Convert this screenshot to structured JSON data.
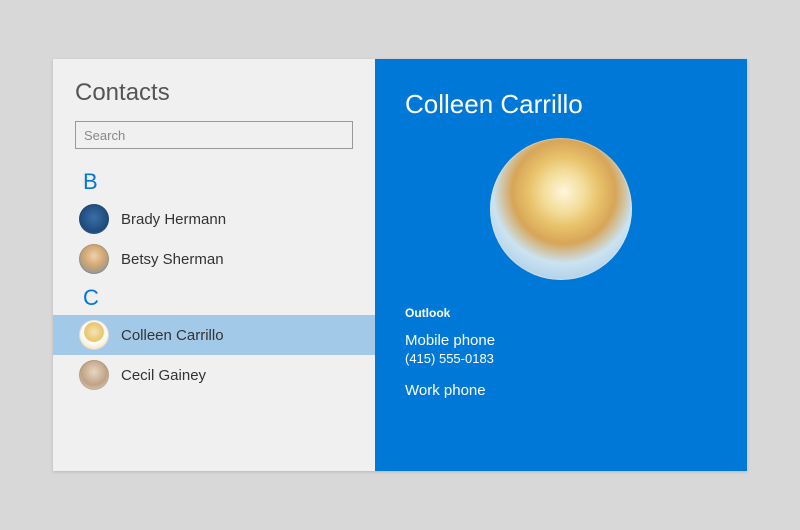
{
  "sidebar": {
    "title": "Contacts",
    "search_placeholder": "Search",
    "groups": [
      {
        "letter": "B",
        "items": [
          {
            "name": "Brady Hermann",
            "avatar": "av-brady",
            "selected": false
          },
          {
            "name": "Betsy Sherman",
            "avatar": "av-betsy",
            "selected": false
          }
        ]
      },
      {
        "letter": "C",
        "items": [
          {
            "name": "Colleen Carrillo",
            "avatar": "av-colleen",
            "selected": true
          },
          {
            "name": "Cecil Gainey",
            "avatar": "av-cecil",
            "selected": false
          }
        ]
      }
    ]
  },
  "detail": {
    "name": "Colleen Carrillo",
    "source": "Outlook",
    "fields": [
      {
        "label": "Mobile phone",
        "value": "(415) 555-0183"
      },
      {
        "label": "Work phone",
        "value": ""
      }
    ]
  },
  "colors": {
    "accent": "#0078d7",
    "selected_row": "#a3c9e9",
    "sidebar_bg": "#f0f0f0"
  }
}
